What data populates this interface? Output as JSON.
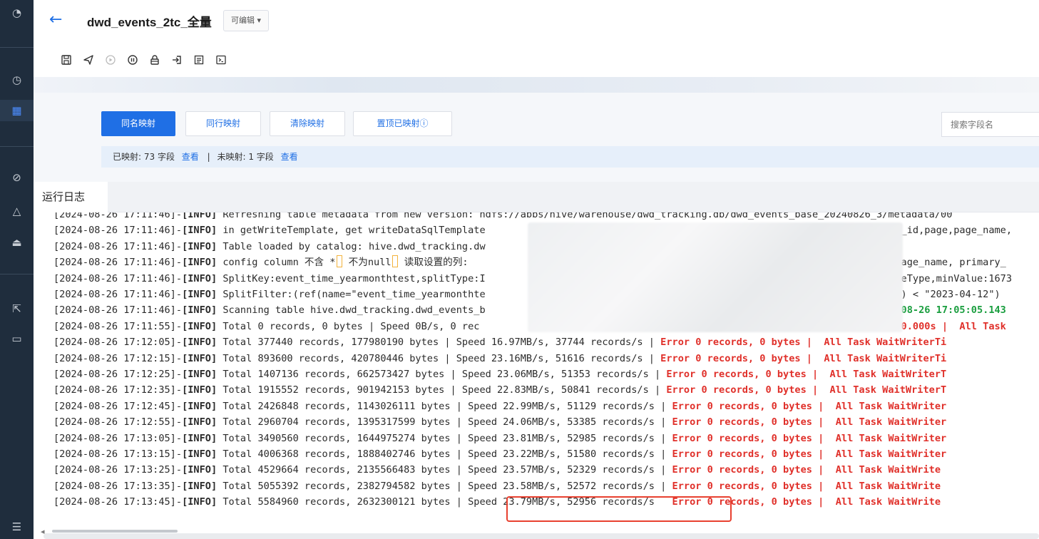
{
  "rail": {
    "icons": [
      "pie-chart-icon",
      "clock-icon",
      "table-icon",
      "compass-icon",
      "warning-icon",
      "monitor-icon",
      "share-icon",
      "folder-icon",
      "menu-fold-icon"
    ]
  },
  "header": {
    "title": "dwd_events_2tc_全量",
    "edit_badge": "可编辑 ▾",
    "toolbar": [
      "save-icon",
      "publish-icon",
      "run-icon",
      "pause-icon",
      "lock-icon",
      "import-icon",
      "format-icon",
      "terminal-icon"
    ]
  },
  "mapping": {
    "buttons": [
      "同名映射",
      "同行映射",
      "清除映射",
      "置顶已映射ⓘ"
    ],
    "search_placeholder": "搜索字段名",
    "summary": {
      "mapped": "已映射: 73 字段",
      "view1": "查看",
      "sep": "|",
      "unmapped": "未映射: 1 字段",
      "view2": "查看"
    }
  },
  "log": {
    "tab": "运行日志",
    "lines": [
      {
        "ts": "[2024-08-26 17:11:46]-",
        "lvl": "[INFO]",
        "msg": " Refreshing table metadata from new version: hdfs://abbs/hive/warehouse/dwd_tracking.db/dwd_events_base_20240826_3/metadata/00"
      },
      {
        "ts": "[2024-08-26 17:11:46]-",
        "lvl": "[INFO]",
        "msg": " in getWriteTemplate, get writeDataSqlTemplate",
        "tail": "pen_id,page,page_name,"
      },
      {
        "ts": "[2024-08-26 17:11:46]-",
        "lvl": "[INFO]",
        "msg": " Table loaded by catalog: hive.dwd_tracking.dw"
      },
      {
        "ts": "[2024-08-26 17:11:46]-",
        "lvl": "[INFO]",
        "msg": " config column 不含 *",
        "mid": " 不为null",
        "msg2": " 读取设置的列:",
        "tail": ", page_name, primary_"
      },
      {
        "ts": "[2024-08-26 17:11:46]-",
        "lvl": "[INFO]",
        "msg": " SplitKey:event_time_yearmonthtest,splitType:I",
        "tail": "DateType,minValue:1673"
      },
      {
        "ts": "[2024-08-26 17:11:46]-",
        "lvl": "[INFO]",
        "msg": " SplitFilter:(ref(name=\"event_time_yearmonthte",
        "tail": "st\") < \"2023-04-12\")"
      },
      {
        "ts": "[2024-08-26 17:11:46]-",
        "lvl": "[INFO]",
        "msg": " Scanning table hive.dwd_tracking.dwd_events_b",
        "tail_green": "24-08-26 17:05:05.143"
      },
      {
        "ts": "[2024-08-26 17:11:55]-",
        "lvl": "[INFO]",
        "msg": " Total 0 records, 0 bytes | Speed 0B/s, 0 rec",
        "tail_err": "me 0.000s |  All Task"
      },
      {
        "ts": "[2024-08-26 17:12:05]-",
        "lvl": "[INFO]",
        "msg": " Total 377440 records, 177980190 bytes | Speed 16.97MB/s, 37744 records/s | ",
        "err": "Error 0 records, 0 bytes |  All Task WaitWriterTi"
      },
      {
        "ts": "[2024-08-26 17:12:15]-",
        "lvl": "[INFO]",
        "msg": " Total 893600 records, 420780446 bytes | Speed 23.16MB/s, 51616 records/s | ",
        "err": "Error 0 records, 0 bytes |  All Task WaitWriterTi"
      },
      {
        "ts": "[2024-08-26 17:12:25]-",
        "lvl": "[INFO]",
        "msg": " Total 1407136 records, 662573427 bytes | Speed 23.06MB/s, 51353 records/s | ",
        "err": "Error 0 records, 0 bytes |  All Task WaitWriterT"
      },
      {
        "ts": "[2024-08-26 17:12:35]-",
        "lvl": "[INFO]",
        "msg": " Total 1915552 records, 901942153 bytes | Speed 22.83MB/s, 50841 records/s | ",
        "err": "Error 0 records, 0 bytes |  All Task WaitWriterT"
      },
      {
        "ts": "[2024-08-26 17:12:45]-",
        "lvl": "[INFO]",
        "msg": " Total 2426848 records, 1143026111 bytes | Speed 22.99MB/s, 51129 records/s | ",
        "err": "Error 0 records, 0 bytes |  All Task WaitWriter"
      },
      {
        "ts": "[2024-08-26 17:12:55]-",
        "lvl": "[INFO]",
        "msg": " Total 2960704 records, 1395317599 bytes | Speed 24.06MB/s, 53385 records/s | ",
        "err": "Error 0 records, 0 bytes |  All Task WaitWriter"
      },
      {
        "ts": "[2024-08-26 17:13:05]-",
        "lvl": "[INFO]",
        "msg": " Total 3490560 records, 1644975274 bytes | Speed 23.81MB/s, 52985 records/s | ",
        "err": "Error 0 records, 0 bytes |  All Task WaitWriter"
      },
      {
        "ts": "[2024-08-26 17:13:15]-",
        "lvl": "[INFO]",
        "msg": " Total 4006368 records, 1888402746 bytes | Speed 23.22MB/s, 51580 records/s | ",
        "err": "Error 0 records, 0 bytes |  All Task WaitWriter"
      },
      {
        "ts": "[2024-08-26 17:13:25]-",
        "lvl": "[INFO]",
        "msg": " Total 4529664 records, 2135566483 bytes | Speed 23.57MB/s, 52329 records/s | ",
        "err": "Error 0 records, 0 bytes |  All Task WaitWrite"
      },
      {
        "ts": "[2024-08-26 17:13:35]-",
        "lvl": "[INFO]",
        "msg": " Total 5055392 records, 2382794582 bytes | Speed 23.58MB/s, 52572 records/s | ",
        "err": "Error 0 records, 0 bytes |  All Task WaitWrite"
      },
      {
        "ts": "[2024-08-26 17:13:45]-",
        "lvl": "[INFO]",
        "msg": " Total 5584960 records, 2632300121 bytes | Speed 23.79MB/s, 52956 records/s   ",
        "err": "Error 0 records, 0 bytes |  All Task WaitWrite"
      }
    ]
  },
  "colors": {
    "accent": "#1f6fe5",
    "error": "#e0302a",
    "success": "#1a9e3f",
    "highlight_box": "#e8402f",
    "rail_bg": "#1f2d3d"
  }
}
